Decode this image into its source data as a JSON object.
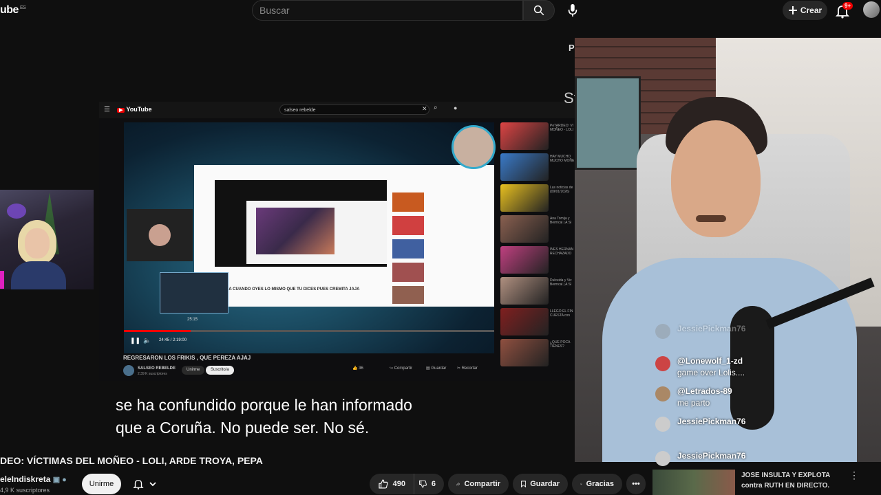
{
  "topbar": {
    "logo": "ube",
    "logo_region": "ES",
    "search_placeholder": "Buscar",
    "create_label": "Crear",
    "notif_badge": "9+"
  },
  "inner_screen": {
    "logo": "YouTube",
    "search_text": "salseo rebelde",
    "video_title": "REGRESARON LOS FRIKIS , QUE PEREZA AJAJ",
    "channel": "SALSEO REBELDE",
    "subs": "2.39 K suscriptores",
    "join": "Unirme",
    "subscribed": "Suscrito/a",
    "time": "24:45 / 2:19:00",
    "likes": "36",
    "share": "Compartir",
    "save": "Guardar",
    "clip": "Recortar",
    "timestamp_tip": "25:15",
    "nested_caption": "CA CUANDO OYES LO MISMO QUE TU DICES PUES CREMITA JAJA",
    "recs": [
      {
        "text": "PeTARDEO: VÍ MOÑEO - LOLI",
        "color": "#d44"
      },
      {
        "text": "HAY MUCHO MUCHO MOÑE",
        "color": "#3a7ac8"
      },
      {
        "text": "Las noticias de (09/01/2026)",
        "color": "#e8c020"
      },
      {
        "text": "Ana Tomija y Bermcal | A SI",
        "color": "#8a6050"
      },
      {
        "text": "INÉS HERNAN RECHAZADO",
        "color": "#c04080"
      },
      {
        "text": "Dulceida y Vic Bermcal | A SI",
        "color": "#b09080"
      },
      {
        "text": "LLEGÓ EL FIN CUESTA con",
        "color": "#802020"
      },
      {
        "text": "¿QUÉ POCA TIENES?",
        "color": "#905040"
      }
    ]
  },
  "subtitles": {
    "line1": "se ha confundido porque le han informado",
    "line2": "que a Coruña. No puede ser. No sé."
  },
  "video": {
    "title": "DEO: VÍCTIMAS DEL MOÑEO - LOLI, ARDE TROYA, PEPA",
    "channel": "eleIndiskreta",
    "subs": "4,9 K suscriptores",
    "join": "Unirme",
    "likes": "490",
    "dislikes": "6",
    "share": "Compartir",
    "save": "Guardar",
    "thanks": "Gracias"
  },
  "chat": [
    {
      "name": "JessiePickman76",
      "msg": "",
      "color": "#888"
    },
    {
      "name": "@Lonewolf_1-zd",
      "msg": "game over Lolis....",
      "color": "#c44"
    },
    {
      "name": "@Letrados-89",
      "msg": "me parto",
      "color": "#a86"
    },
    {
      "name": "JessiePickman76",
      "msg": "",
      "color": "#ccc"
    },
    {
      "name": "JessiePickman76",
      "msg": "",
      "color": "#ccc"
    }
  ],
  "promo": {
    "line1": "JOSE INSULTA Y EXPLOTA",
    "line2": "contra RUTH EN DIRECTO."
  },
  "right_edge": {
    "p": "P",
    "st": "St"
  },
  "colors": {
    "bg": "#0f0f0f",
    "accent": "#ff0000"
  }
}
